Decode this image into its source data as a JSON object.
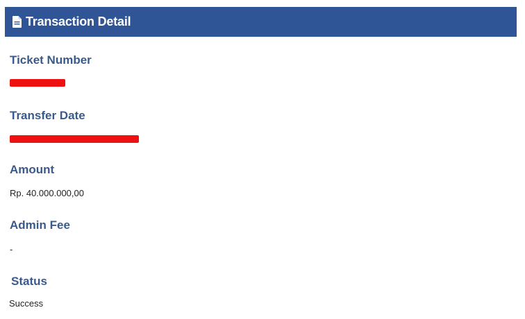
{
  "header": {
    "title": "Transaction Detail",
    "icon": "document-icon",
    "background_color": "#2f5597"
  },
  "fields": {
    "ticket_number": {
      "label": "Ticket Number",
      "redacted": true
    },
    "transfer_date": {
      "label": "Transfer Date",
      "redacted": true
    },
    "amount": {
      "label": "Amount",
      "value": "Rp. 40.000.000,00"
    },
    "admin_fee": {
      "label": "Admin Fee",
      "value": "-"
    },
    "status": {
      "label": "Status",
      "value": "Success"
    }
  },
  "colors": {
    "label": "#3a5a8c",
    "value": "#222222",
    "redaction": "#ee1111"
  }
}
